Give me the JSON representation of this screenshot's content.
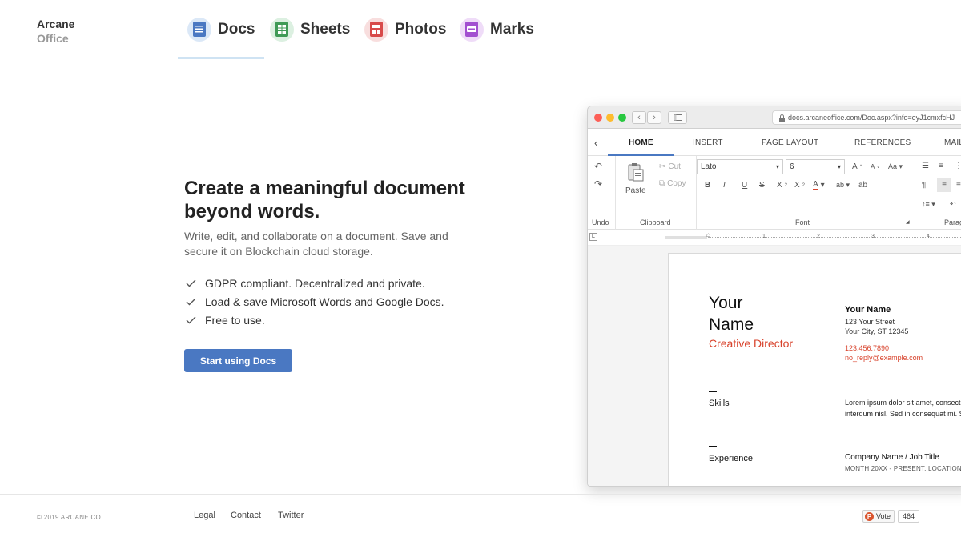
{
  "brand": {
    "line1": "Arcane",
    "line2": "Office"
  },
  "nav": {
    "tabs": [
      {
        "label": "Docs",
        "color": "#4a78c2",
        "bg": "#dbe8f7",
        "active": true
      },
      {
        "label": "Sheets",
        "color": "#3f9a56",
        "bg": "#dcf0e1",
        "active": false
      },
      {
        "label": "Photos",
        "color": "#d84a4a",
        "bg": "#f8dede",
        "active": false
      },
      {
        "label": "Marks",
        "color": "#a24fd0",
        "bg": "#efdcf8",
        "active": false
      }
    ]
  },
  "hero": {
    "title": "Create a meaningful document beyond words.",
    "subtitle": "Write, edit, and collaborate on a document. Save and secure it on Blockchain cloud storage.",
    "features": [
      "GDPR compliant. Decentralized and private.",
      "Load & save Microsoft Words and Google Docs.",
      "Free to use."
    ],
    "cta_label": "Start using Docs"
  },
  "browser": {
    "url": "docs.arcaneoffice.com/Doc.aspx?info=eyJ1cmxfcHJ"
  },
  "editor": {
    "ribbon_tabs": [
      "HOME",
      "INSERT",
      "PAGE LAYOUT",
      "REFERENCES",
      "MAIL"
    ],
    "groups": {
      "undo": "Undo",
      "clipboard": "Clipboard",
      "font": "Font",
      "paragraph": "Parag"
    },
    "paste": "Paste",
    "cut": "Cut",
    "copy": "Copy",
    "font_name": "Lato",
    "font_size": "6",
    "ruler_marks": [
      "1",
      "2",
      "3",
      "4"
    ]
  },
  "resume": {
    "name_line1": "Your",
    "name_line2": "Name",
    "role": "Creative Director",
    "contact_name": "Your Name",
    "street": "123 Your Street",
    "city": "Your City, ST 12345",
    "phone": "123.456.7890",
    "email": "no_reply@example.com",
    "skills_title": "Skills",
    "skills_line1": "Lorem ipsum dolor sit amet, consecte",
    "skills_line2": "interdum nisl. Sed in consequat mi. S",
    "experience_title": "Experience",
    "company": "Company Name / Job Title",
    "dates": "MONTH 20XX - PRESENT,  LOCATION"
  },
  "footer": {
    "copyright": "© 2019 ARCANE CO",
    "links": [
      "Legal",
      "Contact",
      "Twitter"
    ],
    "vote_label": "Vote",
    "vote_count": "464"
  }
}
